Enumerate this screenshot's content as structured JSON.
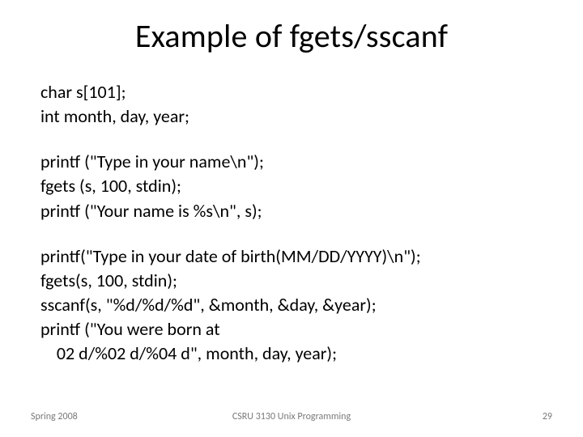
{
  "title": "Example of fgets/sscanf",
  "code": {
    "l1": "char s[101];",
    "l2": "int month, day, year;",
    "l3": "printf (\"Type in your name\\n\");",
    "l4": "fgets (s, 100, stdin);",
    "l5": "printf (\"Your name is %s\\n\", s);",
    "l6": "printf(\"Type in your date of birth(MM/DD/YYYY)\\n\");",
    "l7": "fgets(s, 100, stdin);",
    "l8": "sscanf(s, \"%d/%d/%d\", &month, &day, &year);",
    "l9": "printf (\"You were born at",
    "l10": "    02 d/%02 d/%04 d\", month, day, year);"
  },
  "footer": {
    "left": "Spring 2008",
    "center": "CSRU 3130 Unix Programming",
    "right": "29"
  }
}
